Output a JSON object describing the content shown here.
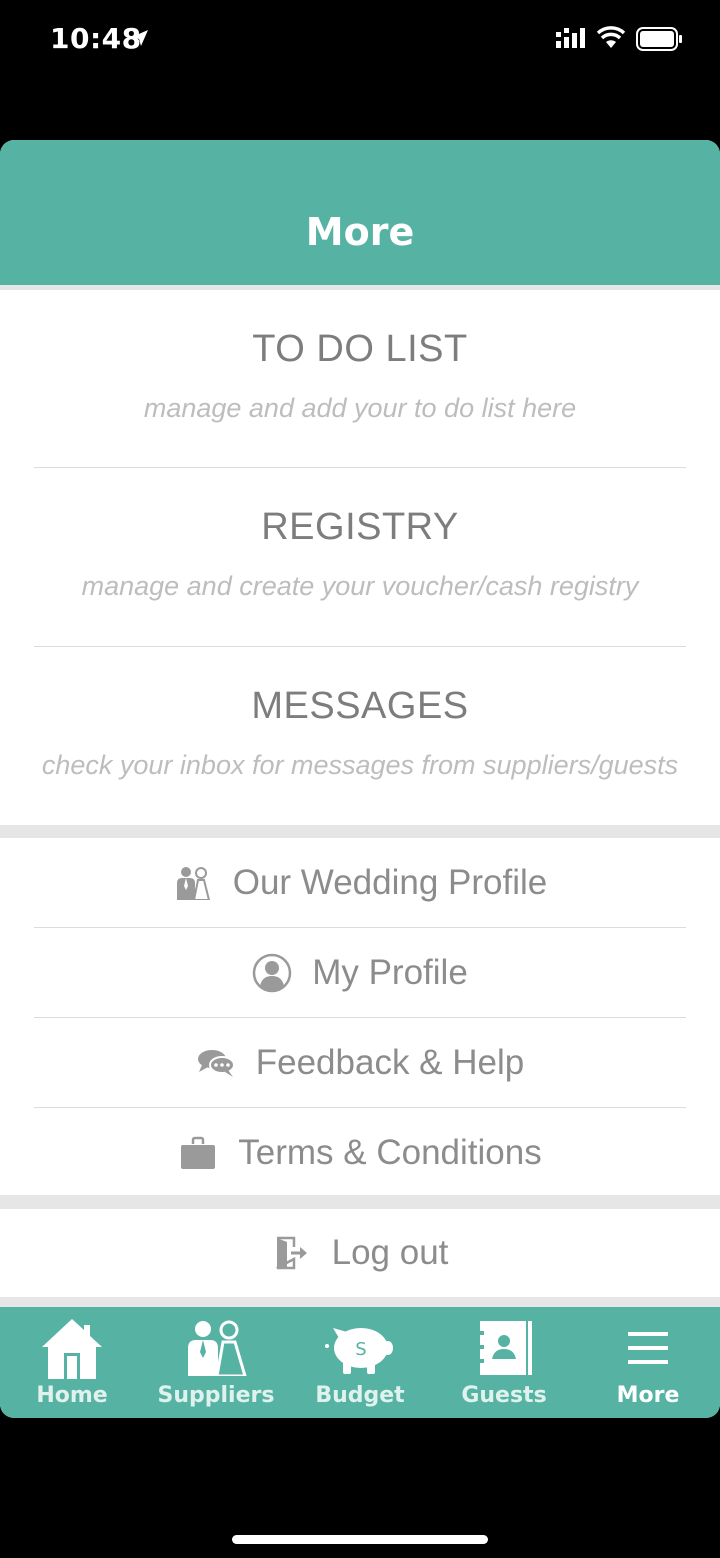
{
  "status_bar": {
    "time": "10:48"
  },
  "header": {
    "title": "More"
  },
  "main_items": [
    {
      "title": "TO DO LIST",
      "subtitle": "manage and add your to do list here"
    },
    {
      "title": "REGISTRY",
      "subtitle": "manage and create your voucher/cash registry"
    },
    {
      "title": "MESSAGES",
      "subtitle": "check your inbox for messages from suppliers/guests"
    }
  ],
  "links": [
    {
      "label": "Our Wedding Profile",
      "icon": "couple-icon"
    },
    {
      "label": "My Profile",
      "icon": "user-icon"
    },
    {
      "label": "Feedback & Help",
      "icon": "chat-icon"
    },
    {
      "label": "Terms & Conditions",
      "icon": "briefcase-icon"
    }
  ],
  "logout": {
    "label": "Log out",
    "icon": "logout-icon"
  },
  "tabs": [
    {
      "label": "Home",
      "icon": "home-icon"
    },
    {
      "label": "Suppliers",
      "icon": "couple-icon"
    },
    {
      "label": "Budget",
      "icon": "piggy-bank-icon"
    },
    {
      "label": "Guests",
      "icon": "address-book-icon"
    },
    {
      "label": "More",
      "icon": "menu-icon",
      "active": true
    }
  ],
  "colors": {
    "accent": "#56b3a3",
    "title_text": "#7d7d7d",
    "subtitle_text": "#bdbdbd"
  }
}
